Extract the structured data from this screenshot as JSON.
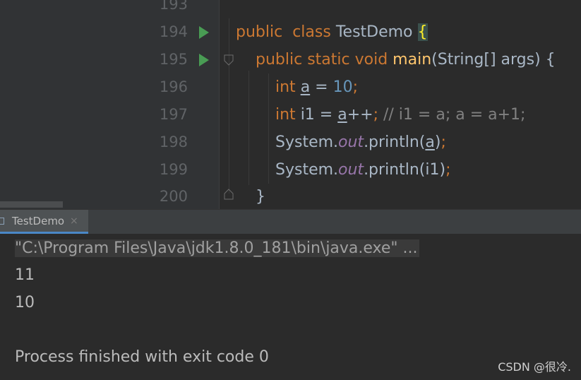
{
  "editor": {
    "partial_line_number": "193",
    "lines": [
      {
        "number": "194"
      },
      {
        "number": "195"
      },
      {
        "number": "196"
      },
      {
        "number": "197"
      },
      {
        "number": "198"
      },
      {
        "number": "199"
      },
      {
        "number": "200"
      }
    ],
    "tokens": {
      "l194": {
        "public": "public",
        "class": "class",
        "name": "TestDemo",
        "brace": "{"
      },
      "l195": {
        "public": "public",
        "static": "static",
        "void": "void",
        "main": "main",
        "params": "(String[] args) {"
      },
      "l196": {
        "int": "int",
        "var": "a",
        "eq": " = ",
        "num": "10",
        "semi": ";"
      },
      "l197": {
        "int": "int",
        "decl": "i1 = ",
        "var": "a",
        "op": "++",
        "semi": ";",
        "comment": " // i1 = a; a = a+1;"
      },
      "l198": {
        "sys": "System.",
        "out": "out",
        "call": ".println(",
        "arg": "a",
        "close": ")",
        "semi": ";"
      },
      "l199": {
        "sys": "System.",
        "out": "out",
        "call": ".println(i1)",
        "semi": ";"
      },
      "l200": {
        "brace": "}"
      }
    },
    "run_icon": "run-gutter-icon",
    "fold_icon": "fold-marker-icon"
  },
  "run_window": {
    "tab_label": "TestDemo",
    "tab_close": "×",
    "tab_icon": "console-icon",
    "console": {
      "command": "\"C:\\Program Files\\Java\\jdk1.8.0_181\\bin\\java.exe\" ...",
      "output": [
        "11",
        "10"
      ],
      "exit_message": "Process finished with exit code 0"
    }
  },
  "watermark": "CSDN @很冷.",
  "colors": {
    "background": "#2b2b2b",
    "keyword": "#cc7832",
    "method": "#ffc66d",
    "number": "#6897bb",
    "comment": "#808080",
    "static_field": "#9876aa",
    "run_green": "#499c54"
  }
}
